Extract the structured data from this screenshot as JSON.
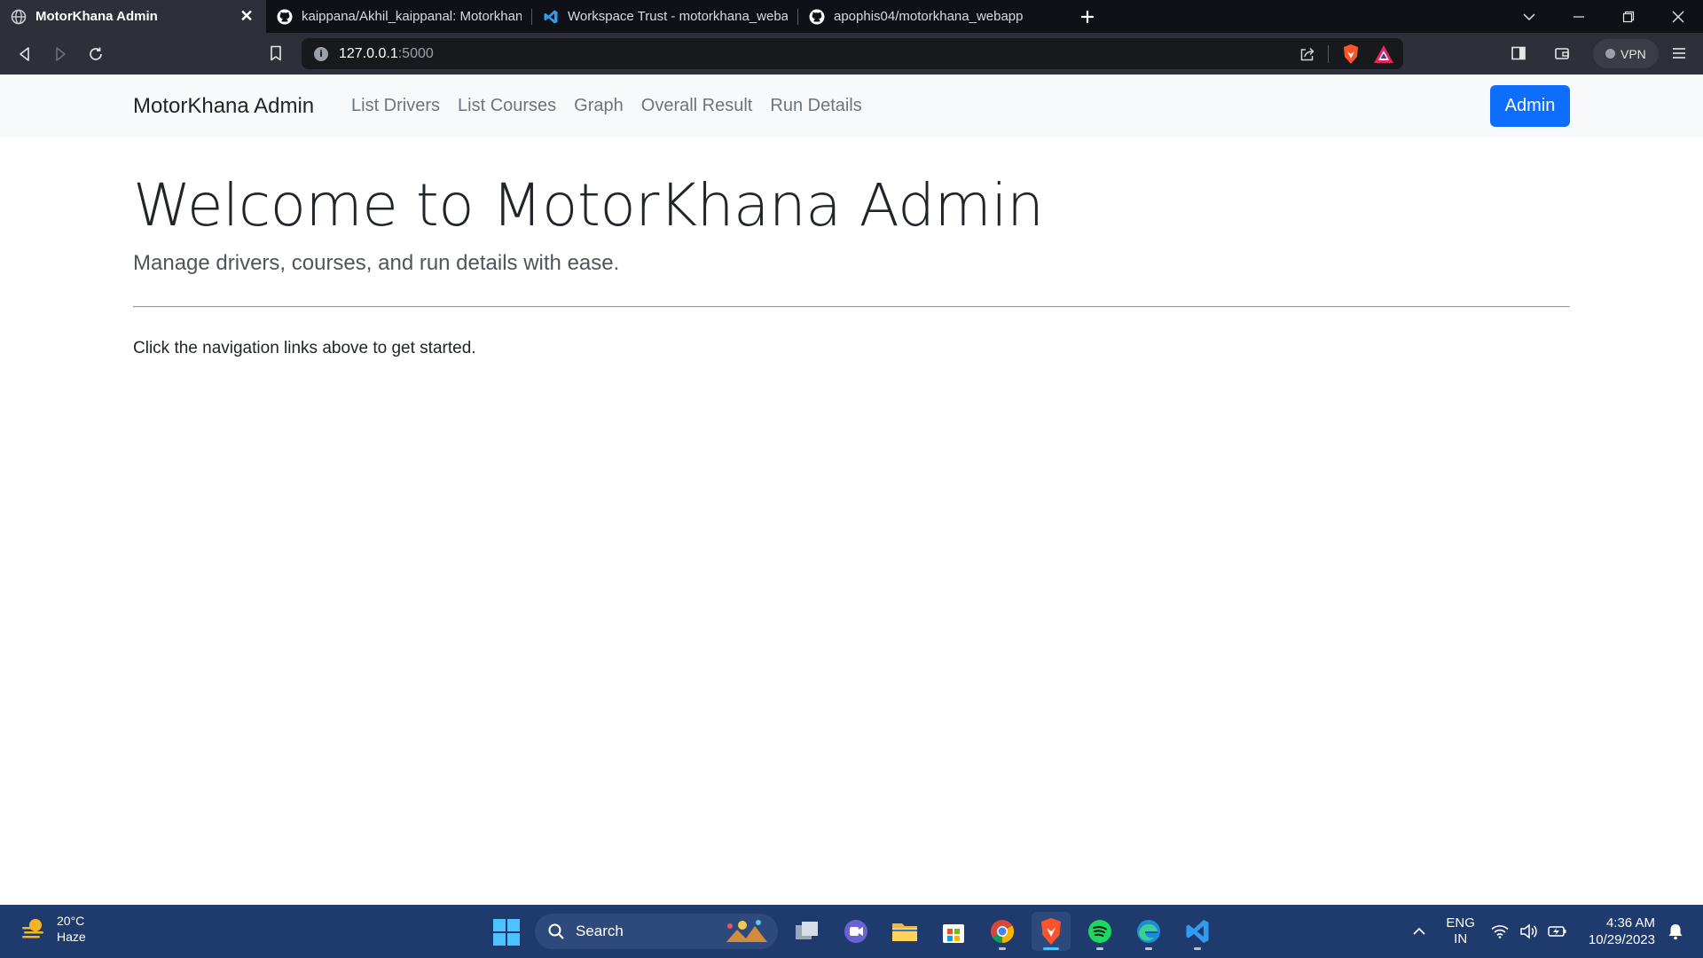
{
  "browser": {
    "tabs": [
      {
        "title": "MotorKhana Admin",
        "icon": "globe-icon",
        "active": true
      },
      {
        "title": "kaippana/Akhil_kaippanal: Motorkhana",
        "icon": "github-icon",
        "active": false
      },
      {
        "title": "Workspace Trust - motorkhana_webapp",
        "icon": "vscode-icon",
        "active": false
      },
      {
        "title": "apophis04/motorkhana_webapp",
        "icon": "github-icon",
        "active": false
      }
    ],
    "url_host": "127.0.0.1",
    "url_port": ":5000",
    "vpn_label": "VPN"
  },
  "navbar": {
    "brand": "MotorKhana Admin",
    "links": [
      "List Drivers",
      "List Courses",
      "Graph",
      "Overall Result",
      "Run Details"
    ],
    "admin_button": "Admin",
    "accent_color": "#0d6efd"
  },
  "main": {
    "title": "Welcome to MotorKhana Admin",
    "lead": "Manage drivers, courses, and run details with ease.",
    "hint": "Click the navigation links above to get started."
  },
  "taskbar": {
    "weather_temp": "20°C",
    "weather_desc": "Haze",
    "search_label": "Search",
    "apps": [
      "file-explorer-icon",
      "meet-icon",
      "folder-icon",
      "store-icon",
      "chrome-icon",
      "brave-icon",
      "spotify-icon",
      "edge-icon",
      "vscode-icon"
    ],
    "active_app": "brave-icon",
    "lang_line1": "ENG",
    "lang_line2": "IN",
    "time": "4:36 AM",
    "date": "10/29/2023"
  }
}
